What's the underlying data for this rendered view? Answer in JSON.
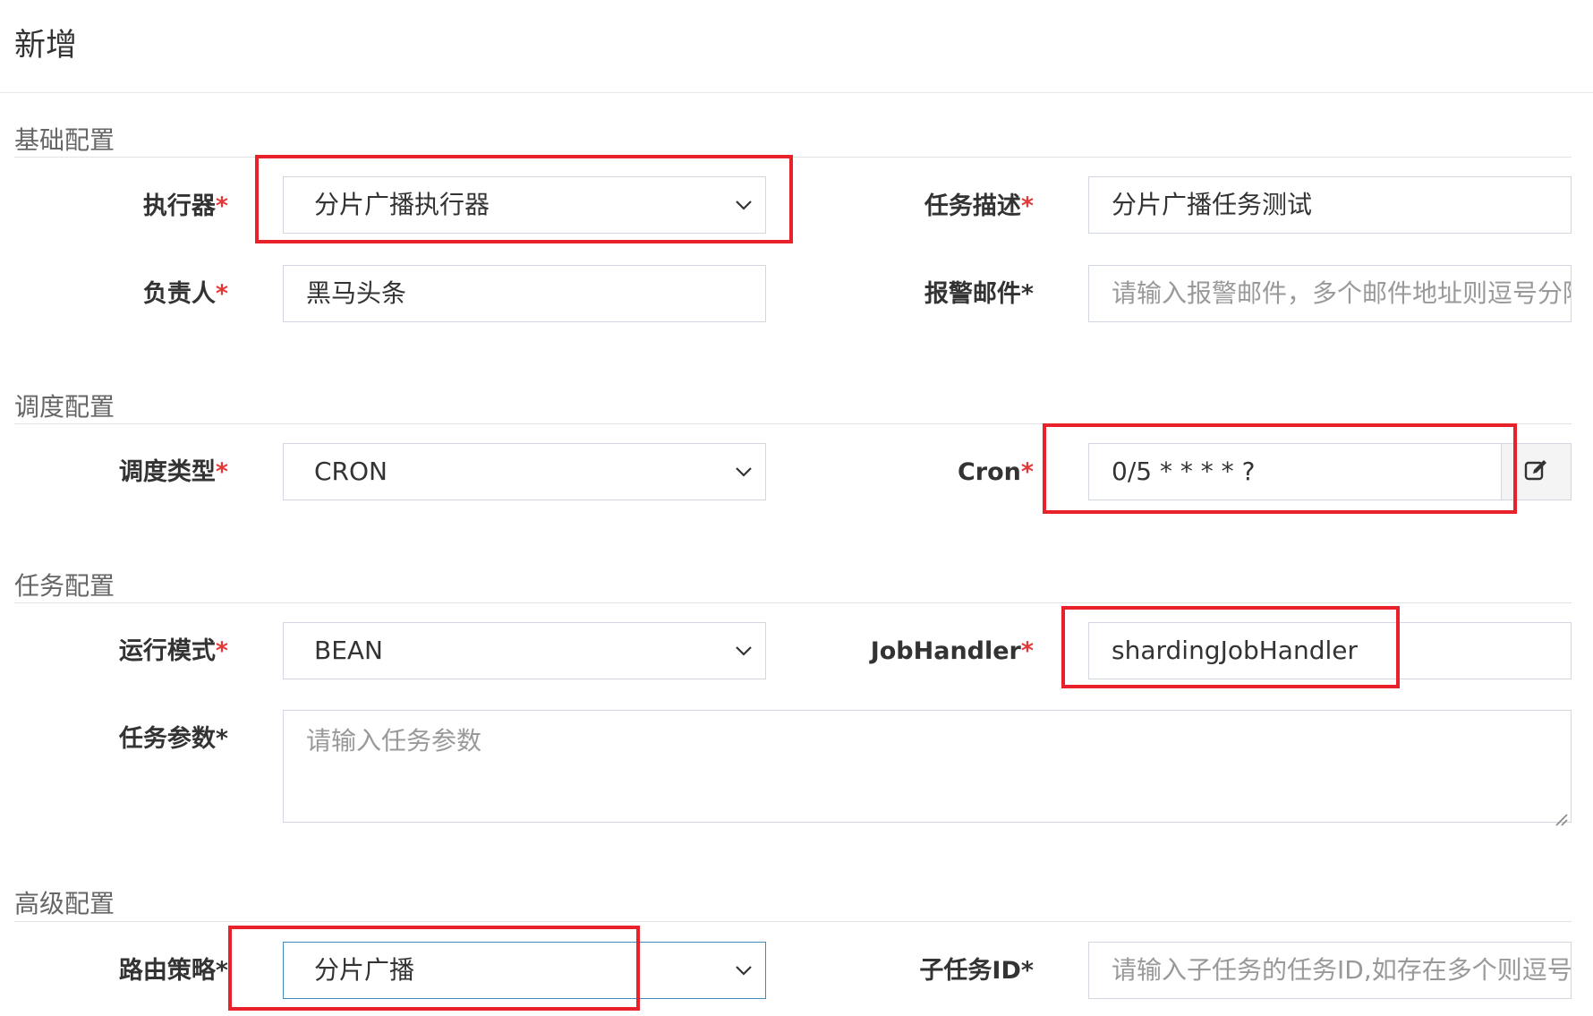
{
  "header": {
    "title": "新增"
  },
  "sections": {
    "basic": "基础配置",
    "schedule": "调度配置",
    "task": "任务配置",
    "advanced": "高级配置"
  },
  "fields": {
    "executor": {
      "label": "执行器",
      "value": "分片广播执行器"
    },
    "job_desc": {
      "label": "任务描述",
      "value": "分片广播任务测试"
    },
    "author": {
      "label": "负责人",
      "value": "黑马头条"
    },
    "alarm_email": {
      "label": "报警邮件",
      "placeholder": "请输入报警邮件，多个邮件地址则逗号分隔"
    },
    "schedule_type": {
      "label": "调度类型",
      "value": "CRON"
    },
    "cron": {
      "label": "Cron",
      "value": "0/5 * * * * ?"
    },
    "glue_type": {
      "label": "运行模式",
      "value": "BEAN"
    },
    "job_handler": {
      "label": "JobHandler",
      "value": "shardingJobHandler"
    },
    "job_param": {
      "label": "任务参数",
      "placeholder": "请输入任务参数"
    },
    "route": {
      "label": "路由策略",
      "value": "分片广播"
    },
    "child_job": {
      "label": "子任务ID",
      "placeholder": "请输入子任务的任务ID,如存在多个则逗号分隔"
    }
  },
  "required_mark": "*",
  "icons": {
    "select_arrow": "chevron-down-icon",
    "cron_edit": "edit-icon"
  },
  "colors": {
    "required": "#e23838",
    "highlight_box": "#e8212a",
    "focus_border": "#3c8dbc"
  }
}
